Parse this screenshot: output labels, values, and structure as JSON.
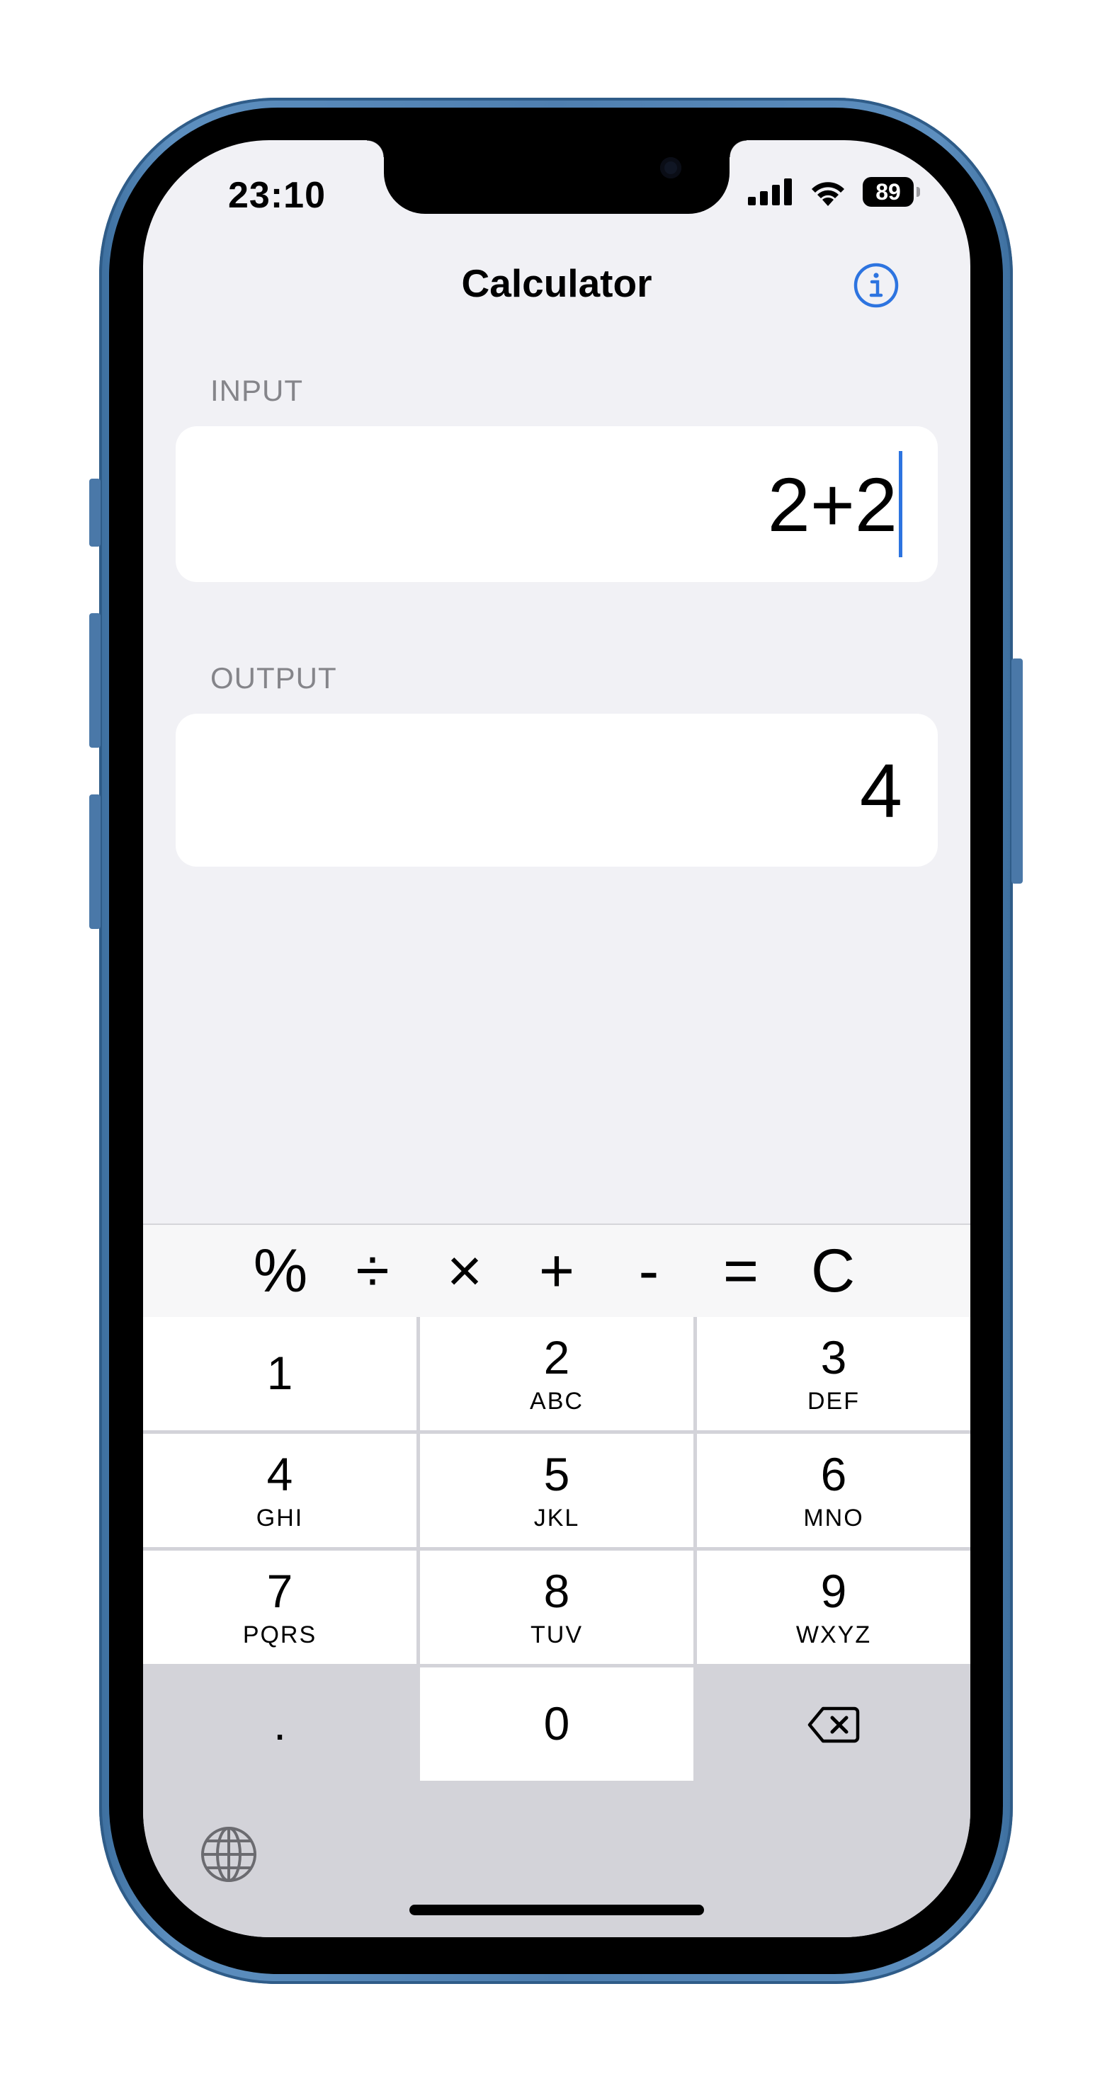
{
  "status_bar": {
    "time": "23:10",
    "battery": "89",
    "icons": [
      "cellular-signal-icon",
      "wifi-icon",
      "battery-icon"
    ]
  },
  "nav": {
    "title": "Calculator",
    "info_icon": "info-circle-icon",
    "accent_color": "#2d74e0"
  },
  "input_section": {
    "label": "INPUT",
    "value": "2+2"
  },
  "output_section": {
    "label": "OUTPUT",
    "value": "4"
  },
  "keyboard": {
    "accessory_keys": [
      "%",
      "÷",
      "×",
      "+",
      "-",
      "=",
      "C"
    ],
    "rows": [
      [
        {
          "num": "1",
          "letters": ""
        },
        {
          "num": "2",
          "letters": "ABC"
        },
        {
          "num": "3",
          "letters": "DEF"
        }
      ],
      [
        {
          "num": "4",
          "letters": "GHI"
        },
        {
          "num": "5",
          "letters": "JKL"
        },
        {
          "num": "6",
          "letters": "MNO"
        }
      ],
      [
        {
          "num": "7",
          "letters": "PQRS"
        },
        {
          "num": "8",
          "letters": "TUV"
        },
        {
          "num": "9",
          "letters": "WXYZ"
        }
      ]
    ],
    "bottom_row": {
      "decimal": ".",
      "zero": "0",
      "delete_icon": "delete-backspace-icon"
    },
    "globe_icon": "globe-icon"
  }
}
